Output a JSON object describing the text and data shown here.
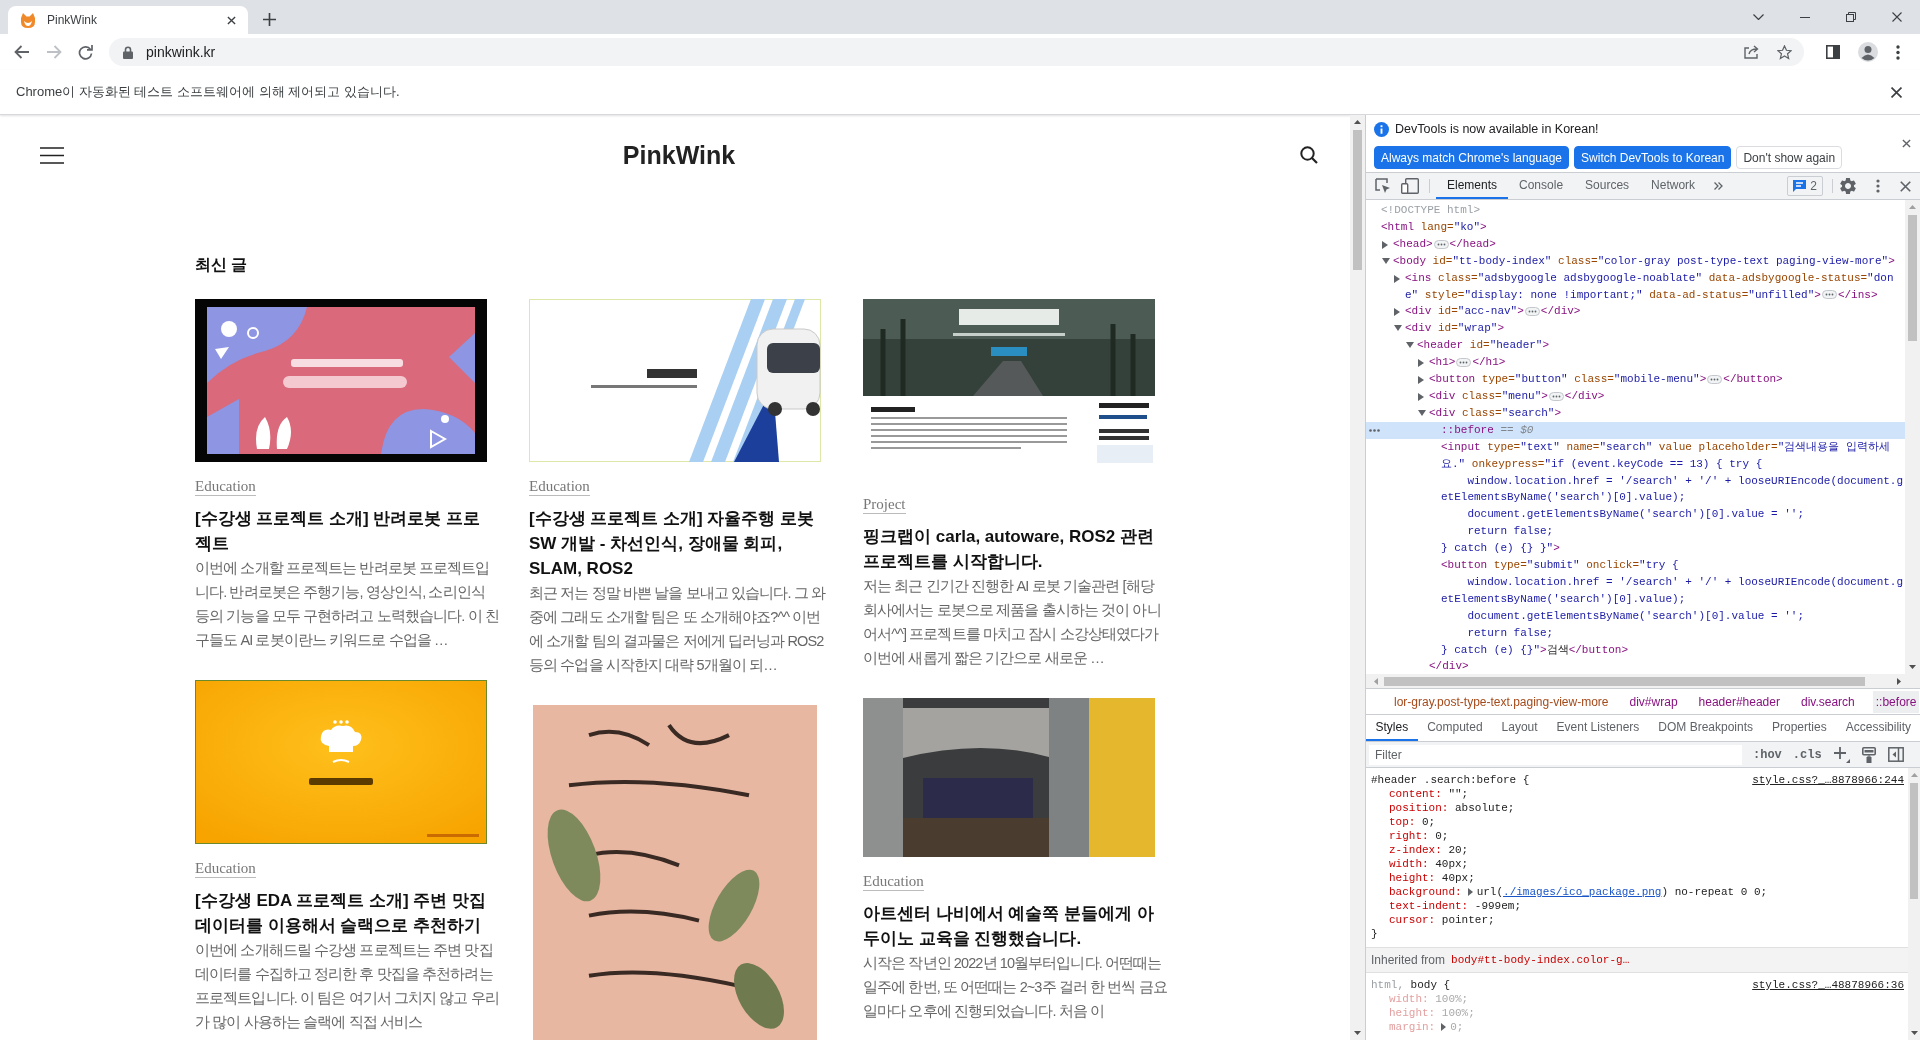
{
  "browser": {
    "tab": {
      "title": "PinkWink"
    },
    "nav_buttons": [
      {
        "kind": "back",
        "disabled": false
      },
      {
        "kind": "forward",
        "disabled": true
      },
      {
        "kind": "reload",
        "disabled": false
      }
    ],
    "address": "pinkwink.kr",
    "infobar": {
      "message": "Chrome이 자동화된 테스트 소프트웨어에 의해 제어되고 있습니다."
    }
  },
  "page": {
    "site_title": "PinkWink",
    "section_title": "최신 글",
    "columns": [
      {
        "cards": [
          {
            "thumbnail": {
              "kind": "robot-slide"
            },
            "category": "Education",
            "title": "[수강생 프로젝트 소개] 반려로봇 프로젝트",
            "excerpt": "이번에 소개할 프로젝트는 반려로봇 프로젝트입니다. 반려로봇은 주행기능, 영상인식, 소리인식 등의 기능을 모두 구현하려고 노력했습니다. 이 친구들도 AI 로봇이란느 키워드로 수업을 …"
          },
          {
            "thumbnail": {
              "kind": "menu-slide"
            },
            "category": "Education",
            "title": "[수강생 EDA 프로젝트 소개] 주변 맛집 데이터를 이용해서 슬랙으로 추천하기",
            "excerpt": "이번에 소개해드릴 수강생 프로젝트는 주변 맛집 데이터를 수집하고 정리한 후 맛집을 추천하려는 프로젝트입니다. 이 팀은 여기서 그치지 않고 우리가 많이 사용하는 슬랙에 직접 서비스"
          }
        ]
      },
      {
        "cards": [
          {
            "thumbnail": {
              "kind": "vehicle-slide"
            },
            "category": "Education",
            "title": "[수강생 프로젝트 소개] 자율주행 로봇 SW 개발 - 차선인식, 장애물 회피, SLAM, ROS2",
            "excerpt": "최근 저는 정말 바쁜 날을 보내고 있습니다. 그 와중에 그래도 소개할 팀은 또 소개해야죠?^^ 이번에 소개할 팀의 결과물은 저에게 딥러닝과 ROS2 등의 수업을 시작한지 대략 5개월이 되…"
          },
          {
            "thumbnail": {
              "kind": "calligraphy-photo"
            }
          }
        ]
      },
      {
        "cards": [
          {
            "thumbnail": {
              "kind": "website"
            },
            "category": "Project",
            "title": "핑크랩이 carla, autoware, ROS2 관련 프로젝트를 시작합니다.",
            "excerpt": "저는 최근 긴기간 진행한 AI 로봇 기술관련 [해당회사에서는 로봇으로 제품을 출시하는 것이 아니어서^^] 프로젝트를 마치고 잠시 소강상태였다가 이번에 새롭게 짧은 기간으로 새로운 …"
          },
          {
            "thumbnail": {
              "kind": "interior-photo"
            },
            "category": "Education",
            "title": "아트센터 나비에서 예술쪽 분들에게 아두이노 교육을 진행했습니다.",
            "excerpt": "시작은 작년인 2022년 10월부터입니다. 어떤때는 일주에 한번, 또 어떤때는 2~3주 걸러 한 번씩 금요일마다 오후에 진행되었습니다. 처음 이"
          }
        ]
      }
    ]
  },
  "devtools": {
    "notice": {
      "message": "DevTools is now available in Korean!",
      "buttons": [
        {
          "label": "Always match Chrome's language",
          "kind": "primary"
        },
        {
          "label": "Switch DevTools to Korean",
          "kind": "primary"
        },
        {
          "label": "Don't show again",
          "kind": "secondary"
        }
      ]
    },
    "tabs": [
      {
        "label": "Elements",
        "selected": true
      },
      {
        "label": "Console",
        "selected": false
      },
      {
        "label": "Sources",
        "selected": false
      },
      {
        "label": "Network",
        "selected": false
      }
    ],
    "issues_count": "2",
    "dom_tree": [
      {
        "kind": "leaf",
        "selected": false,
        "lines": [
          [
            {
              "kind": "doctype",
              "text": "<!DOCTYPE html>"
            }
          ]
        ]
      },
      {
        "kind": "root",
        "selected": false,
        "lines": [
          [
            {
              "kind": "tag",
              "text": "<html"
            },
            {
              "kind": "attr",
              "text": " lang="
            },
            {
              "kind": "value",
              "text": "\"ko\""
            },
            {
              "kind": "tag",
              "text": ">"
            }
          ]
        ],
        "children": [
          {
            "kind": "element",
            "expanded": false,
            "selected": false,
            "lines": [
              [
                {
                  "kind": "tag",
                  "text": "<head>"
                }
              ]
            ],
            "close": [
              {
                "kind": "tag",
                "text": "</head>"
              }
            ]
          },
          {
            "kind": "element",
            "expanded": true,
            "selected": false,
            "lines": [
              [
                {
                  "kind": "tag",
                  "text": "<body"
                },
                {
                  "kind": "attr",
                  "text": " id="
                },
                {
                  "kind": "value",
                  "text": "\"tt-body-index\""
                },
                {
                  "kind": "attr",
                  "text": " class="
                },
                {
                  "kind": "value",
                  "text": "\"color-gray post-type-text paging-view-more\""
                },
                {
                  "kind": "tag",
                  "text": ">"
                }
              ]
            ],
            "children": [
              {
                "kind": "element",
                "expanded": false,
                "selected": false,
                "lines": [
                  [
                    {
                      "kind": "tag",
                      "text": "<ins"
                    },
                    {
                      "kind": "attr",
                      "text": " class="
                    },
                    {
                      "kind": "value",
                      "text": "\"adsbygoogle adsbygoogle-noablate\""
                    },
                    {
                      "kind": "attr",
                      "text": " data-adsbygoogle-status="
                    },
                    {
                      "kind": "value",
                      "text": "\"don"
                    }
                  ],
                  [
                    {
                      "kind": "value",
                      "text": "e\""
                    },
                    {
                      "kind": "attr",
                      "text": " style="
                    },
                    {
                      "kind": "value",
                      "text": "\"display: none !important;\""
                    },
                    {
                      "kind": "attr",
                      "text": " data-ad-status="
                    },
                    {
                      "kind": "value",
                      "text": "\"unfilled\""
                    },
                    {
                      "kind": "tag",
                      "text": ">"
                    }
                  ]
                ],
                "close": [
                  {
                    "kind": "tag",
                    "text": "</ins>"
                  }
                ]
              },
              {
                "kind": "element",
                "expanded": false,
                "selected": false,
                "lines": [
                  [
                    {
                      "kind": "tag",
                      "text": "<div"
                    },
                    {
                      "kind": "attr",
                      "text": " id="
                    },
                    {
                      "kind": "value",
                      "text": "\"acc-nav\""
                    },
                    {
                      "kind": "tag",
                      "text": ">"
                    }
                  ]
                ],
                "close": [
                  {
                    "kind": "tag",
                    "text": "</div>"
                  }
                ]
              },
              {
                "kind": "element",
                "expanded": true,
                "selected": false,
                "lines": [
                  [
                    {
                      "kind": "tag",
                      "text": "<div"
                    },
                    {
                      "kind": "attr",
                      "text": " id="
                    },
                    {
                      "kind": "value",
                      "text": "\"wrap\""
                    },
                    {
                      "kind": "tag",
                      "text": ">"
                    }
                  ]
                ],
                "children": [
                  {
                    "kind": "element",
                    "expanded": true,
                    "selected": false,
                    "lines": [
                      [
                        {
                          "kind": "tag",
                          "text": "<header"
                        },
                        {
                          "kind": "attr",
                          "text": " id="
                        },
                        {
                          "kind": "value",
                          "text": "\"header\""
                        },
                        {
                          "kind": "tag",
                          "text": ">"
                        }
                      ]
                    ],
                    "children": [
                      {
                        "kind": "element",
                        "expanded": false,
                        "selected": false,
                        "lines": [
                          [
                            {
                              "kind": "tag",
                              "text": "<h1>"
                            }
                          ]
                        ],
                        "close": [
                          {
                            "kind": "tag",
                            "text": "</h1>"
                          }
                        ]
                      },
                      {
                        "kind": "element",
                        "expanded": false,
                        "selected": false,
                        "lines": [
                          [
                            {
                              "kind": "tag",
                              "text": "<button"
                            },
                            {
                              "kind": "attr",
                              "text": " type="
                            },
                            {
                              "kind": "value",
                              "text": "\"button\""
                            },
                            {
                              "kind": "attr",
                              "text": " class="
                            },
                            {
                              "kind": "value",
                              "text": "\"mobile-menu\""
                            },
                            {
                              "kind": "tag",
                              "text": ">"
                            }
                          ]
                        ],
                        "close": [
                          {
                            "kind": "tag",
                            "text": "</button>"
                          }
                        ]
                      },
                      {
                        "kind": "element",
                        "expanded": false,
                        "selected": false,
                        "lines": [
                          [
                            {
                              "kind": "tag",
                              "text": "<div"
                            },
                            {
                              "kind": "attr",
                              "text": " class="
                            },
                            {
                              "kind": "value",
                              "text": "\"menu\""
                            },
                            {
                              "kind": "tag",
                              "text": ">"
                            }
                          ]
                        ],
                        "close": [
                          {
                            "kind": "tag",
                            "text": "</div>"
                          }
                        ]
                      },
                      {
                        "kind": "element",
                        "expanded": true,
                        "selected": false,
                        "lines": [
                          [
                            {
                              "kind": "tag",
                              "text": "<div"
                            },
                            {
                              "kind": "attr",
                              "text": " class="
                            },
                            {
                              "kind": "value",
                              "text": "\"search\""
                            },
                            {
                              "kind": "tag",
                              "text": ">"
                            }
                          ]
                        ],
                        "close": [
                          {
                            "kind": "tag",
                            "text": "</div>"
                          }
                        ],
                        "children": [
                          {
                            "kind": "leaf",
                            "selected": true,
                            "lines": [
                              [
                                {
                                  "kind": "pseudo",
                                  "text": "::before"
                                },
                                {
                                  "kind": "note",
                                  "text": " == $0"
                                }
                              ]
                            ]
                          },
                          {
                            "kind": "leaf",
                            "selected": false,
                            "lines": [
                              [
                                {
                                  "kind": "tag",
                                  "text": "<input"
                                },
                                {
                                  "kind": "attr",
                                  "text": " type="
                                },
                                {
                                  "kind": "value",
                                  "text": "\"text\""
                                },
                                {
                                  "kind": "attr",
                                  "text": " name="
                                },
                                {
                                  "kind": "value",
                                  "text": "\"search\""
                                },
                                {
                                  "kind": "attr",
                                  "text": " value"
                                },
                                {
                                  "kind": "attr",
                                  "text": " placeholder="
                                },
                                {
                                  "kind": "value",
                                  "text": "\"검색내용을 입력하세"
                                }
                              ],
                              [
                                {
                                  "kind": "value",
                                  "text": "요.\""
                                },
                                {
                                  "kind": "attr",
                                  "text": " onkeypress="
                                },
                                {
                                  "kind": "value",
                                  "text": "\"if (event.keyCode == 13) { try {"
                                }
                              ],
                              [
                                {
                                  "kind": "value",
                                  "text": "    window.location.href = '/search' + '/' + looseURIEncode(document.g"
                                }
                              ],
                              [
                                {
                                  "kind": "value",
                                  "text": "etElementsByName('search')[0].value);"
                                }
                              ],
                              [
                                {
                                  "kind": "value",
                                  "text": "    document.getElementsByName('search')[0].value = '';"
                                }
                              ],
                              [
                                {
                                  "kind": "value",
                                  "text": "    return false;"
                                }
                              ],
                              [
                                {
                                  "kind": "value",
                                  "text": "} catch (e) {} }\""
                                },
                                {
                                  "kind": "tag",
                                  "text": ">"
                                }
                              ]
                            ]
                          },
                          {
                            "kind": "leaf",
                            "selected": false,
                            "lines": [
                              [
                                {
                                  "kind": "tag",
                                  "text": "<button"
                                },
                                {
                                  "kind": "attr",
                                  "text": " type="
                                },
                                {
                                  "kind": "value",
                                  "text": "\"submit\""
                                },
                                {
                                  "kind": "attr",
                                  "text": " onclick="
                                },
                                {
                                  "kind": "value",
                                  "text": "\"try {"
                                }
                              ],
                              [
                                {
                                  "kind": "value",
                                  "text": "    window.location.href = '/search' + '/' + looseURIEncode(document.g"
                                }
                              ],
                              [
                                {
                                  "kind": "value",
                                  "text": "etElementsByName('search')[0].value);"
                                }
                              ],
                              [
                                {
                                  "kind": "value",
                                  "text": "    document.getElementsByName('search')[0].value = '';"
                                }
                              ],
                              [
                                {
                                  "kind": "value",
                                  "text": "    return false;"
                                }
                              ],
                              [
                                {
                                  "kind": "value",
                                  "text": "} catch (e) {}\""
                                },
                                {
                                  "kind": "tag",
                                  "text": ">"
                                },
                                {
                                  "kind": "text",
                                  "text": "검색"
                                },
                                {
                                  "kind": "tag",
                                  "text": "</button>"
                                }
                              ]
                            ]
                          }
                        ]
                      }
                    ]
                  }
                ]
              }
            ]
          }
        ]
      }
    ],
    "breadcrumbs": [
      {
        "text": "lor-gray.post-type-text.paging-view-more",
        "kind": "class",
        "selected": false
      },
      {
        "text": "div#wrap",
        "kind": "tag",
        "selected": false
      },
      {
        "text": "header#header",
        "kind": "tag",
        "selected": false
      },
      {
        "text": "div.search",
        "kind": "tag",
        "selected": false
      },
      {
        "text": "::before",
        "kind": "tag",
        "selected": true
      }
    ],
    "panel_tabs": [
      {
        "label": "Styles",
        "selected": true
      },
      {
        "label": "Computed",
        "selected": false
      },
      {
        "label": "Layout",
        "selected": false
      },
      {
        "label": "Event Listeners",
        "selected": false
      },
      {
        "label": "DOM Breakpoints",
        "selected": false
      },
      {
        "label": "Properties",
        "selected": false
      },
      {
        "label": "Accessibility",
        "selected": false
      }
    ],
    "filter": {
      "placeholder": "Filter"
    },
    "filter_toggles": [
      ":hov",
      ".cls"
    ],
    "style_blocks": [
      {
        "kind": "rule",
        "selector": [
          {
            "text": "#header .search:before",
            "matched": true
          }
        ],
        "open": "{",
        "source": "style.css?_…8878966:244",
        "properties": [
          {
            "name": "content:",
            "expandable": false,
            "inactive": false,
            "value": [
              {
                "kind": "plain",
                "text": "\"\";"
              }
            ]
          },
          {
            "name": "position:",
            "expandable": false,
            "inactive": false,
            "value": [
              {
                "kind": "plain",
                "text": "absolute;"
              }
            ]
          },
          {
            "name": "top:",
            "expandable": false,
            "inactive": false,
            "value": [
              {
                "kind": "plain",
                "text": "0;"
              }
            ]
          },
          {
            "name": "right:",
            "expandable": false,
            "inactive": false,
            "value": [
              {
                "kind": "plain",
                "text": "0;"
              }
            ]
          },
          {
            "name": "z-index:",
            "expandable": false,
            "inactive": false,
            "value": [
              {
                "kind": "plain",
                "text": "20;"
              }
            ]
          },
          {
            "name": "width:",
            "expandable": false,
            "inactive": false,
            "value": [
              {
                "kind": "plain",
                "text": "40px;"
              }
            ]
          },
          {
            "name": "height:",
            "expandable": false,
            "inactive": false,
            "value": [
              {
                "kind": "plain",
                "text": "40px;"
              }
            ]
          },
          {
            "name": "background:",
            "expandable": true,
            "inactive": false,
            "value": [
              {
                "kind": "plain",
                "text": "url("
              },
              {
                "kind": "link",
                "text": "./images/ico_package.png"
              },
              {
                "kind": "plain",
                "text": ") no-repeat 0 0;"
              }
            ]
          },
          {
            "name": "text-indent:",
            "expandable": false,
            "inactive": false,
            "value": [
              {
                "kind": "plain",
                "text": "-999em;"
              }
            ]
          },
          {
            "name": "cursor:",
            "expandable": false,
            "inactive": false,
            "value": [
              {
                "kind": "plain",
                "text": "pointer;"
              }
            ]
          }
        ],
        "close": "}"
      },
      {
        "kind": "inherited",
        "label": "Inherited from",
        "element": "body#tt-body-index.color-g…"
      },
      {
        "kind": "rule",
        "selector": [
          {
            "text": "html,",
            "matched": false
          },
          {
            "text": "body",
            "matched": true
          }
        ],
        "open": "{",
        "source": "style.css?_…48878966:36",
        "properties": [
          {
            "name": "width:",
            "expandable": false,
            "inactive": true,
            "value": [
              {
                "kind": "plain",
                "text": "100%;"
              }
            ]
          },
          {
            "name": "height:",
            "expandable": false,
            "inactive": true,
            "value": [
              {
                "kind": "plain",
                "text": "100%;"
              }
            ]
          },
          {
            "name": "margin:",
            "expandable": true,
            "inactive": true,
            "value": [
              {
                "kind": "plain",
                "text": "0;"
              }
            ]
          }
        ]
      }
    ]
  }
}
